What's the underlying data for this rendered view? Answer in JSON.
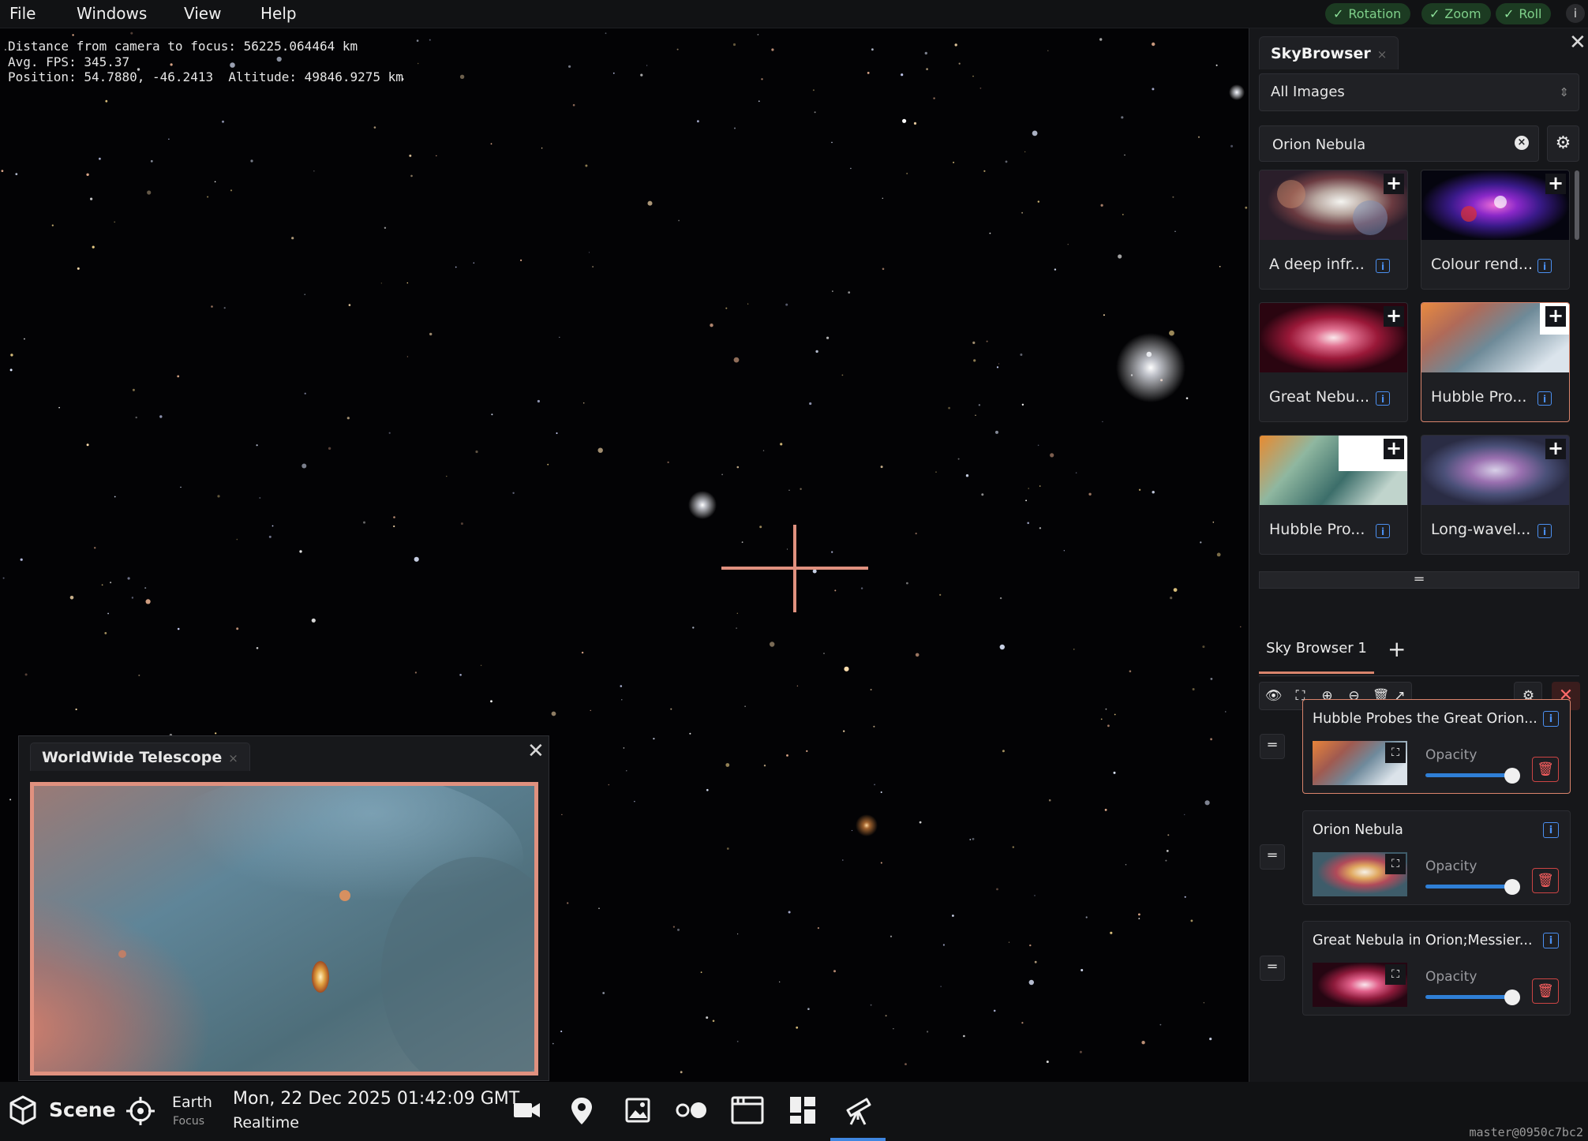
{
  "menu": {
    "file": "File",
    "windows": "Windows",
    "view": "View",
    "help": "Help",
    "toggles": [
      "Rotation",
      "Zoom",
      "Roll"
    ],
    "info": "i"
  },
  "overlay": {
    "line1": "Distance from camera to focus: 56225.064464 km",
    "line2": "Avg. FPS: 345.37",
    "line3": "Position: 54.7880, -46.2413  Altitude: 49846.9275 km"
  },
  "skybrowser": {
    "title": "SkyBrowser",
    "collection": "All Images",
    "search_value": "Orion Nebula",
    "images": [
      {
        "label": "A deep infr..."
      },
      {
        "label": "Colour rend..."
      },
      {
        "label": "Great Nebu..."
      },
      {
        "label": "Hubble Pro..."
      },
      {
        "label": "Hubble Pro..."
      },
      {
        "label": "Long-wavel..."
      }
    ],
    "browser_tab": "Sky Browser 1",
    "selected_images": [
      {
        "title": "Hubble Probes the Great Orion...",
        "opacity_label": "Opacity",
        "opacity": 1.0
      },
      {
        "title": "Orion Nebula",
        "opacity_label": "Opacity",
        "opacity": 1.0
      },
      {
        "title": "Great Nebula in Orion;Messier...",
        "opacity_label": "Opacity",
        "opacity": 1.0
      }
    ]
  },
  "wwt": {
    "title": "WorldWide Telescope"
  },
  "bottom": {
    "scene": "Scene",
    "focus_name": "Earth",
    "focus_label": "Focus",
    "datetime": "Mon, 22 Dec 2025 01:42:09 GMT",
    "time_mode": "Realtime",
    "build": "master@0950c7bc2"
  },
  "colors": {
    "accent": "#d9846c",
    "crosshair": "#e0917f",
    "info": "#4b8ff0",
    "toggle_bg": "#1c3b22",
    "toggle_fg": "#7fd08a"
  }
}
